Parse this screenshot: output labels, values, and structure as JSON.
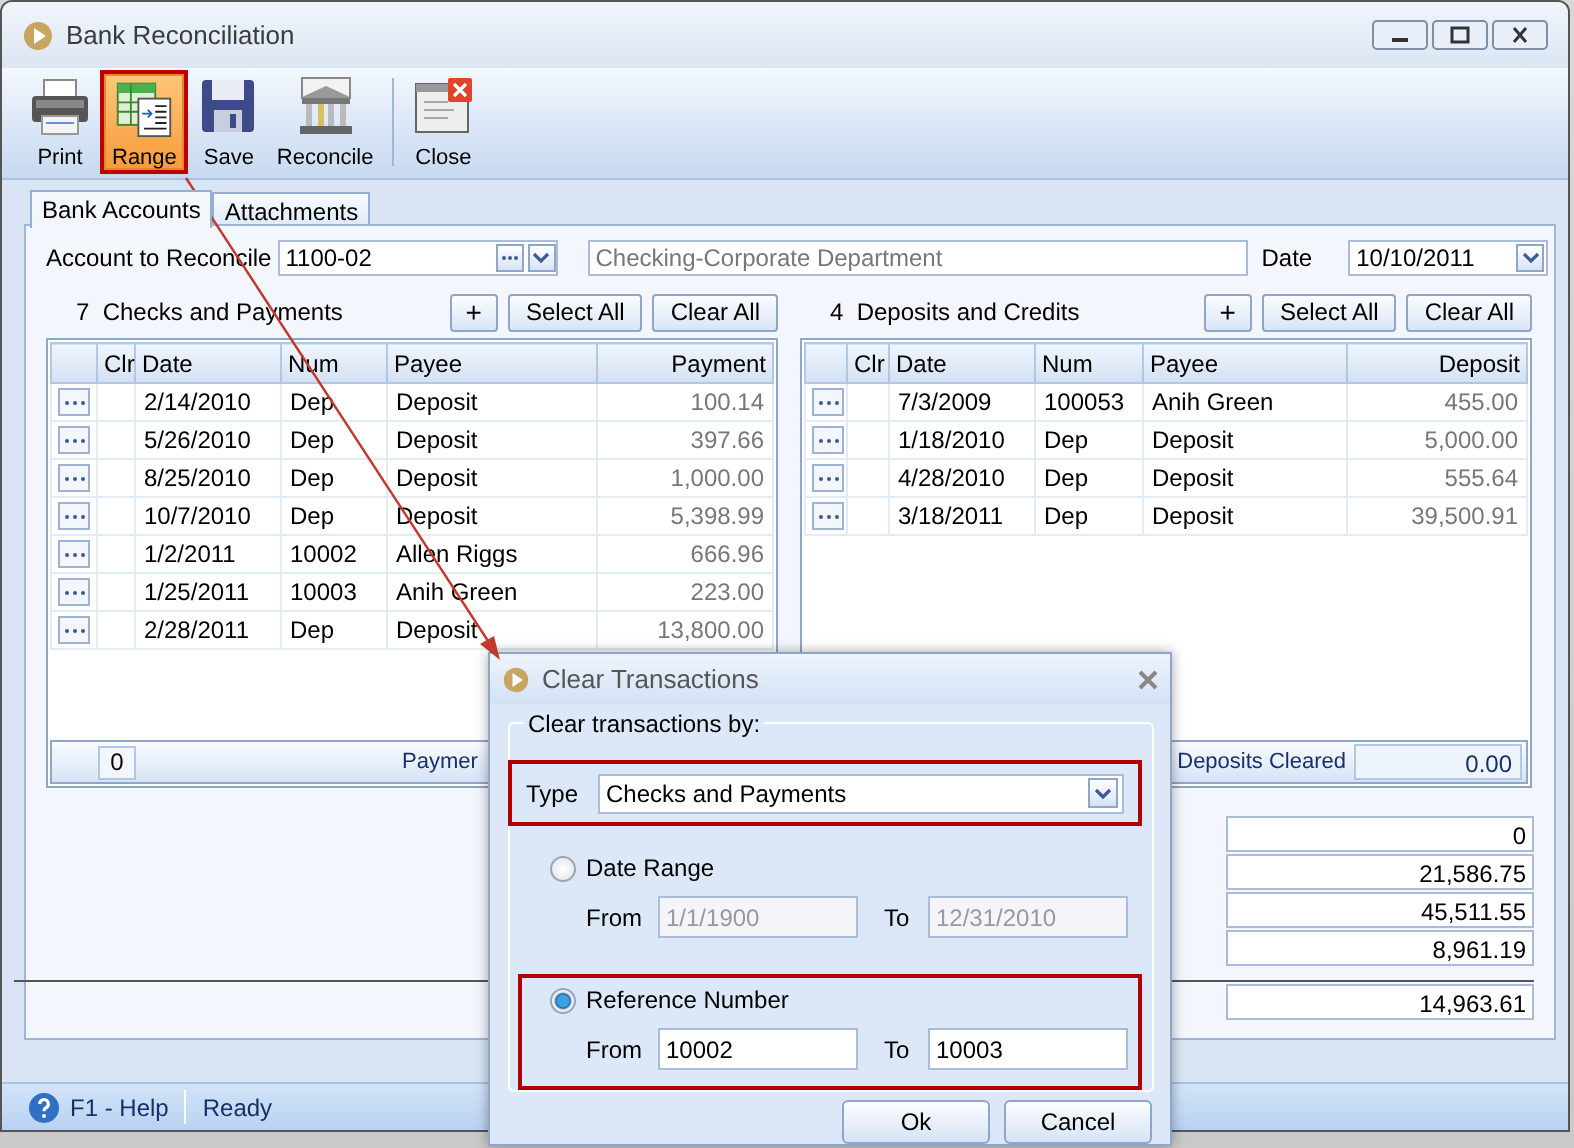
{
  "window": {
    "title": "Bank Reconciliation"
  },
  "toolbar": [
    {
      "label": "Print",
      "kind": "printer",
      "selected": false,
      "annotated": false
    },
    {
      "label": "Range",
      "kind": "range",
      "selected": true,
      "annotated": true
    },
    {
      "label": "Save",
      "kind": "save",
      "selected": false,
      "annotated": false
    },
    {
      "label": "Reconcile",
      "kind": "reconcile",
      "selected": false,
      "annotated": false
    },
    {
      "label": "Close",
      "kind": "close",
      "selected": false,
      "annotated": false
    }
  ],
  "tabs": [
    {
      "label": "Bank Accounts",
      "selected": true
    },
    {
      "label": "Attachments",
      "selected": false
    }
  ],
  "account": {
    "label": "Account to Reconcile",
    "value": "1100-02",
    "description": "Checking-Corporate Department",
    "date_label": "Date",
    "date": "10/10/2011"
  },
  "checks": {
    "count": "7",
    "title": "Checks and Payments",
    "buttons": [
      "+",
      "Select All",
      "Clear All"
    ],
    "columns": [
      "Clr",
      "Date",
      "Num",
      "Payee",
      "Payment"
    ],
    "rows": [
      {
        "date": "2/14/2010",
        "num": "Dep",
        "payee": "Deposit",
        "amount": "100.14"
      },
      {
        "date": "5/26/2010",
        "num": "Dep",
        "payee": "Deposit",
        "amount": "397.66"
      },
      {
        "date": "8/25/2010",
        "num": "Dep",
        "payee": "Deposit",
        "amount": "1,000.00"
      },
      {
        "date": "10/7/2010",
        "num": "Dep",
        "payee": "Deposit",
        "amount": "5,398.99"
      },
      {
        "date": "1/2/2011",
        "num": "10002",
        "payee": "Allen Riggs",
        "amount": "666.96"
      },
      {
        "date": "1/25/2011",
        "num": "10003",
        "payee": "Anih Green",
        "amount": "223.00"
      },
      {
        "date": "2/28/2011",
        "num": "Dep",
        "payee": "Deposit",
        "amount": "13,800.00"
      }
    ],
    "footer": {
      "kind": "count",
      "count": "0",
      "label": "Paymer"
    }
  },
  "deposits": {
    "count": "4",
    "title": "Deposits and Credits",
    "buttons": [
      "+",
      "Select All",
      "Clear All"
    ],
    "columns": [
      "Clr",
      "Date",
      "Num",
      "Payee",
      "Deposit"
    ],
    "rows": [
      {
        "date": "7/3/2009",
        "num": "100053",
        "payee": "Anih Green",
        "amount": "455.00"
      },
      {
        "date": "1/18/2010",
        "num": "Dep",
        "payee": "Deposit",
        "amount": "5,000.00"
      },
      {
        "date": "4/28/2010",
        "num": "Dep",
        "payee": "Deposit",
        "amount": "555.64"
      },
      {
        "date": "3/18/2011",
        "num": "Dep",
        "payee": "Deposit",
        "amount": "39,500.91"
      }
    ],
    "footer": {
      "kind": "total",
      "label": "Deposits Cleared",
      "value": "0.00"
    }
  },
  "summary": [
    "0",
    "21,586.75",
    "45,511.55",
    "8,961.19"
  ],
  "summary_total": "14,963.61",
  "status_bar": {
    "help": "F1 - Help",
    "status": "Ready"
  },
  "dialog": {
    "title": "Clear Transactions",
    "group": "Clear transactions by:",
    "type": {
      "label": "Type",
      "value": "Checks and Payments",
      "annotated": true
    },
    "options": [
      {
        "label": "Date Range",
        "selected": false,
        "annotated": false,
        "from_label": "From",
        "from": "1/1/1900",
        "to_label": "To",
        "to": "12/31/2010"
      },
      {
        "label": "Reference Number",
        "selected": true,
        "annotated": true,
        "from_label": "From",
        "from": "10002",
        "to_label": "To",
        "to": "10003"
      }
    ],
    "buttons": [
      "Ok",
      "Cancel"
    ]
  }
}
